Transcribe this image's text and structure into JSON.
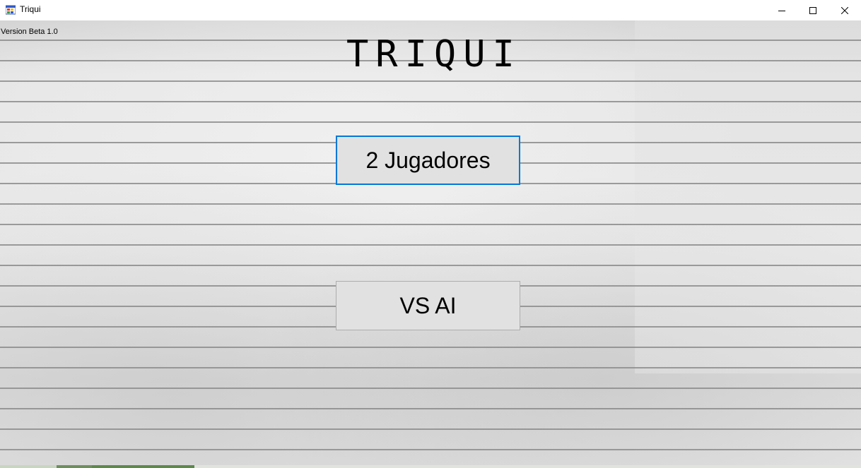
{
  "window": {
    "title": "Triqui",
    "icon": "windows-form-icon",
    "controls": {
      "minimize_icon": "minimize-icon",
      "maximize_icon": "maximize-icon",
      "close_icon": "close-icon"
    }
  },
  "main": {
    "version_label": "Version Beta 1.0",
    "game_title": "TRIQUI",
    "buttons": [
      {
        "label": "2 Jugadores",
        "focused": true
      },
      {
        "label": "VS AI",
        "focused": false
      }
    ]
  },
  "colors": {
    "focus_border": "#0078d7",
    "button_face": "#e1e1e1",
    "button_border": "#adadad"
  }
}
